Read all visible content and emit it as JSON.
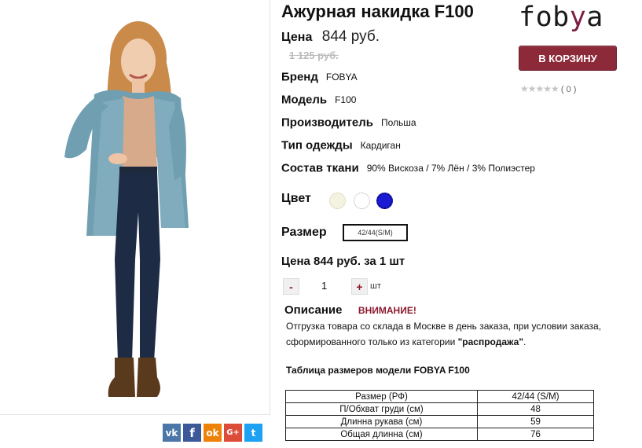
{
  "product": {
    "title": "Ажурная накидка F100",
    "price_label": "Цена",
    "price": "844 руб.",
    "old_price": "1 125 руб.",
    "brand_label": "Бренд",
    "brand": "FOBYA",
    "model_label": "Модель",
    "model": "F100",
    "maker_label": "Производитель",
    "maker": "Польша",
    "type_label": "Тип одежды",
    "type": "Кардиган",
    "fabric_label": "Состав ткани",
    "fabric": "90% Вискоза / 7% Лён / 3% Полиэстер",
    "color_label": "Цвет",
    "colors": [
      "#f4f3df",
      "#ffffff",
      "#1a1ad4"
    ],
    "size_label": "Размер",
    "size": "42/44(S/M)",
    "unit_price": "Цена 844 руб. за 1 шт"
  },
  "quantity": {
    "minus": "-",
    "value": "1",
    "plus": "+",
    "unit": "шт"
  },
  "logo": {
    "text_a": "fob",
    "text_y": "y",
    "text_b": "a"
  },
  "cart_button": "В КОРЗИНУ",
  "rating": {
    "stars": "★★★★★",
    "count": "( 0 )"
  },
  "description": {
    "label": "Описание",
    "warning": "ВНИМАНИЕ!",
    "text_before": "Отгрузка товара со склада в Москве в день заказа, при условии заказа, сформированного только из категории ",
    "text_bold": "\"распродажа\"",
    "text_after": "."
  },
  "size_table": {
    "title": "Таблица размеров модели FOBYA F100",
    "header": [
      "Размер (РФ)",
      "42/44 (S/M)"
    ],
    "rows": [
      [
        "П/Обхват груди (см)",
        "48"
      ],
      [
        "Длинна рукава (см)",
        "59"
      ],
      [
        "Общая длинна (см)",
        "76"
      ]
    ]
  },
  "social": [
    "vk",
    "f",
    "ok",
    "G+",
    "t"
  ],
  "accent_color": "#8c2a3a"
}
